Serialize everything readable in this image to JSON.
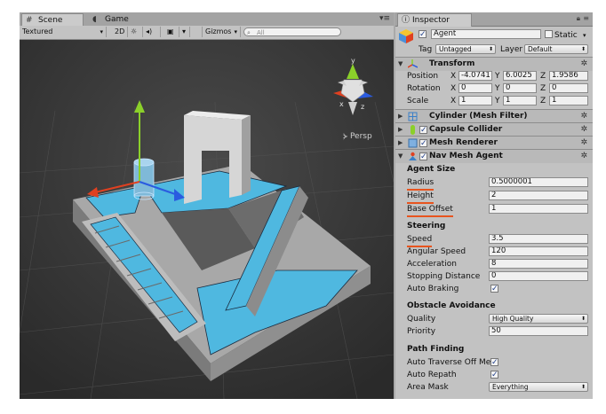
{
  "scene_panel": {
    "tabs": [
      {
        "label": "Scene",
        "icon": "hash-icon"
      },
      {
        "label": "Game",
        "icon": "game-controller-icon"
      }
    ],
    "toolbar": {
      "shading_mode": "Textured",
      "mode_2d": "2D",
      "lighting_icon": "sun-icon",
      "audio_icon": "speaker-icon",
      "effects_icon": "image-icon",
      "gizmos": "Gizmos",
      "search_placeholder": "All"
    },
    "persp_label": "Persp"
  },
  "inspector": {
    "tab_label": "Inspector",
    "object": {
      "name": "Agent",
      "active": true,
      "static_label": "Static",
      "static": false,
      "tag_label": "Tag",
      "tag_value": "Untagged",
      "layer_label": "Layer",
      "layer_value": "Default"
    },
    "transform": {
      "title": "Transform",
      "position_label": "Position",
      "rotation_label": "Rotation",
      "scale_label": "Scale",
      "position": {
        "x": "-4.0741",
        "y": "6.0025",
        "z": "1.9586"
      },
      "rotation": {
        "x": "0",
        "y": "0",
        "z": "0"
      },
      "scale": {
        "x": "1",
        "y": "1",
        "z": "1"
      },
      "axis": {
        "x": "X",
        "y": "Y",
        "z": "Z"
      }
    },
    "components": [
      {
        "name": "Cylinder (Mesh Filter)",
        "enabled_checkbox": false
      },
      {
        "name": "Capsule Collider",
        "enabled_checkbox": true
      },
      {
        "name": "Mesh Renderer",
        "enabled_checkbox": true
      }
    ],
    "nav_mesh_agent": {
      "title": "Nav Mesh Agent",
      "agent_size_header": "Agent Size",
      "radius_label": "Radius",
      "radius": "0.5000001",
      "height_label": "Height",
      "height": "2",
      "base_offset_label": "Base Offset",
      "base_offset": "1",
      "steering_header": "Steering",
      "speed_label": "Speed",
      "speed": "3.5",
      "angular_speed_label": "Angular Speed",
      "angular_speed": "120",
      "acceleration_label": "Acceleration",
      "acceleration": "8",
      "stopping_distance_label": "Stopping Distance",
      "stopping_distance": "0",
      "auto_braking_label": "Auto Braking",
      "auto_braking": true,
      "obstacle_header": "Obstacle Avoidance",
      "quality_label": "Quality",
      "quality": "High Quality",
      "priority_label": "Priority",
      "priority": "50",
      "pathfinding_header": "Path Finding",
      "auto_traverse_label": "Auto Traverse Off Mes",
      "auto_traverse": true,
      "auto_repath_label": "Auto Repath",
      "auto_repath": true,
      "area_mask_label": "Area Mask",
      "area_mask": "Everything"
    }
  },
  "colors": {
    "navmesh": "#4fb8e0",
    "highlight_underline": "#e8541e",
    "scene_bg": "#3c3c3c",
    "inspector_bg": "#c2c2c2"
  }
}
